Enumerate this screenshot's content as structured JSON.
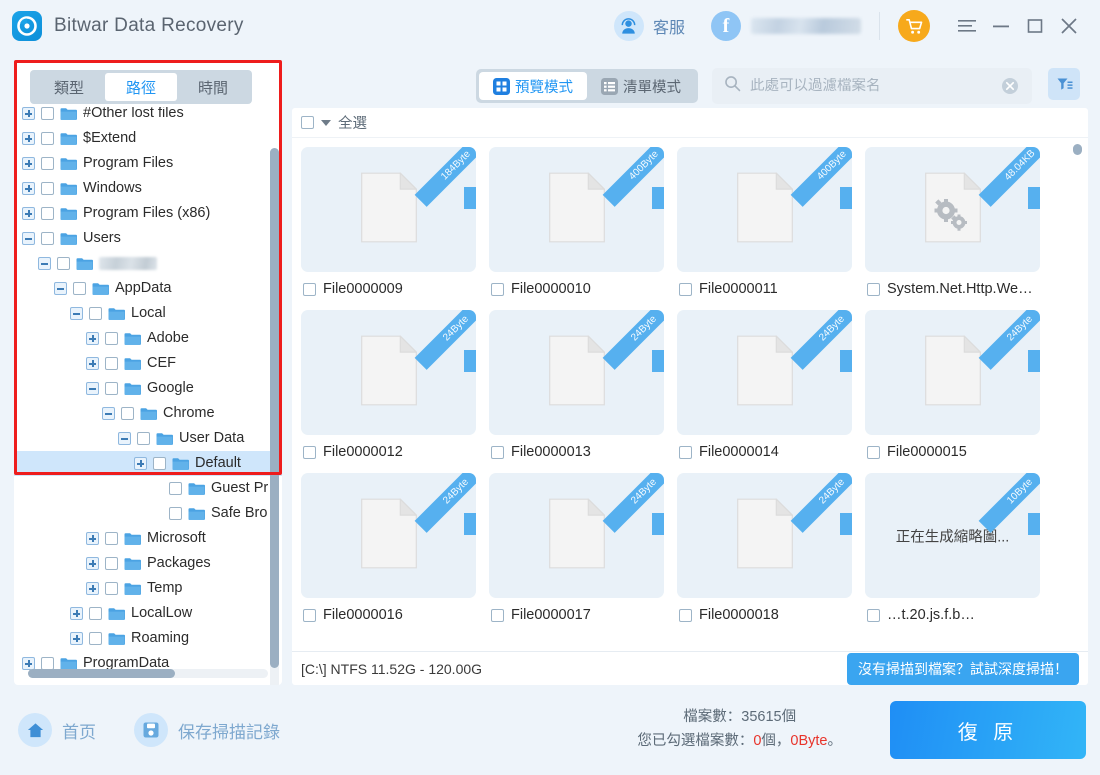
{
  "window": {
    "title": "Bitwar Data Recovery",
    "logo_icon": "bitwar-logo-icon",
    "support_label": "客服",
    "support_icon": "headset-avatar-icon",
    "facebook_icon": "facebook-icon",
    "account_name_redacted": "",
    "cart_icon": "shopping-cart-icon",
    "menu_icon": "hamburger-menu-icon",
    "minimize_icon": "minimize-icon",
    "maximize_icon": "maximize-icon",
    "close_icon": "close-icon"
  },
  "sidebar": {
    "tabs": [
      {
        "label": "類型",
        "active": false
      },
      {
        "label": "路徑",
        "active": true
      },
      {
        "label": "時間",
        "active": false
      }
    ],
    "tree": [
      {
        "label": "#Other lost files",
        "indent": 0,
        "expander": "plus",
        "checkbox": true,
        "selected": false,
        "blurred": false,
        "clipped_top": true
      },
      {
        "label": "$Extend",
        "indent": 0,
        "expander": "plus",
        "checkbox": true,
        "selected": false,
        "blurred": false
      },
      {
        "label": "Program Files",
        "indent": 0,
        "expander": "plus",
        "checkbox": true,
        "selected": false,
        "blurred": false
      },
      {
        "label": "Windows",
        "indent": 0,
        "expander": "plus",
        "checkbox": true,
        "selected": false,
        "blurred": false
      },
      {
        "label": "Program Files (x86)",
        "indent": 0,
        "expander": "plus",
        "checkbox": true,
        "selected": false,
        "blurred": false
      },
      {
        "label": "Users",
        "indent": 0,
        "expander": "minus",
        "checkbox": true,
        "selected": false,
        "blurred": false
      },
      {
        "label": "",
        "indent": 1,
        "expander": "minus",
        "checkbox": true,
        "selected": false,
        "blurred": true
      },
      {
        "label": "AppData",
        "indent": 2,
        "expander": "minus",
        "checkbox": true,
        "selected": false,
        "blurred": false
      },
      {
        "label": "Local",
        "indent": 3,
        "expander": "minus",
        "checkbox": true,
        "selected": false,
        "blurred": false
      },
      {
        "label": "Adobe",
        "indent": 4,
        "expander": "plus",
        "checkbox": true,
        "selected": false,
        "blurred": false
      },
      {
        "label": "CEF",
        "indent": 4,
        "expander": "plus",
        "checkbox": true,
        "selected": false,
        "blurred": false
      },
      {
        "label": "Google",
        "indent": 4,
        "expander": "minus",
        "checkbox": true,
        "selected": false,
        "blurred": false
      },
      {
        "label": "Chrome",
        "indent": 5,
        "expander": "minus",
        "checkbox": true,
        "selected": false,
        "blurred": false
      },
      {
        "label": "User Data",
        "indent": 6,
        "expander": "minus",
        "checkbox": true,
        "selected": false,
        "blurred": false
      },
      {
        "label": "Default",
        "indent": 7,
        "expander": "plus",
        "checkbox": true,
        "selected": true,
        "blurred": false
      },
      {
        "label": "Guest Pr",
        "indent": 8,
        "expander": "none",
        "checkbox": true,
        "selected": false,
        "blurred": false
      },
      {
        "label": "Safe Bro",
        "indent": 8,
        "expander": "none",
        "checkbox": true,
        "selected": false,
        "blurred": false
      },
      {
        "label": "Microsoft",
        "indent": 4,
        "expander": "plus",
        "checkbox": true,
        "selected": false,
        "blurred": false
      },
      {
        "label": "Packages",
        "indent": 4,
        "expander": "plus",
        "checkbox": true,
        "selected": false,
        "blurred": false
      },
      {
        "label": "Temp",
        "indent": 4,
        "expander": "plus",
        "checkbox": true,
        "selected": false,
        "blurred": false
      },
      {
        "label": "LocalLow",
        "indent": 3,
        "expander": "plus",
        "checkbox": true,
        "selected": false,
        "blurred": false
      },
      {
        "label": "Roaming",
        "indent": 3,
        "expander": "plus",
        "checkbox": true,
        "selected": false,
        "blurred": false
      },
      {
        "label": "ProgramData",
        "indent": 0,
        "expander": "plus",
        "checkbox": true,
        "selected": false,
        "blurred": false
      }
    ]
  },
  "toolbar": {
    "modes": [
      {
        "label": "預覽模式",
        "icon": "grid-view-icon",
        "active": true
      },
      {
        "label": "清單模式",
        "icon": "list-view-icon",
        "active": false
      }
    ],
    "search": {
      "placeholder": "此處可以過濾檔案名",
      "value": "",
      "search_icon": "search-icon",
      "clear_icon": "clear-circle-icon"
    },
    "filter_icon": "funnel-filter-icon"
  },
  "main": {
    "select_all_label": "全選",
    "files": [
      {
        "name": "File0000009",
        "size": "184Byte",
        "icon": "blank-document-icon",
        "state": "ready"
      },
      {
        "name": "File0000010",
        "size": "400Byte",
        "icon": "blank-document-icon",
        "state": "ready"
      },
      {
        "name": "File0000011",
        "size": "400Byte",
        "icon": "blank-document-icon",
        "state": "ready"
      },
      {
        "name": "System.Net.Http.We…",
        "size": "48.04KB",
        "icon": "system-dll-document-icon",
        "state": "ready"
      },
      {
        "name": "File0000012",
        "size": "24Byte",
        "icon": "blank-document-icon",
        "state": "ready"
      },
      {
        "name": "File0000013",
        "size": "24Byte",
        "icon": "blank-document-icon",
        "state": "ready"
      },
      {
        "name": "File0000014",
        "size": "24Byte",
        "icon": "blank-document-icon",
        "state": "ready"
      },
      {
        "name": "File0000015",
        "size": "24Byte",
        "icon": "blank-document-icon",
        "state": "ready"
      },
      {
        "name": "File0000016",
        "size": "24Byte",
        "icon": "blank-document-icon",
        "state": "ready"
      },
      {
        "name": "File0000017",
        "size": "24Byte",
        "icon": "blank-document-icon",
        "state": "ready"
      },
      {
        "name": "File0000018",
        "size": "24Byte",
        "icon": "blank-document-icon",
        "state": "ready"
      },
      {
        "name": "…t.20.js.f.b…",
        "size": "10Byte",
        "icon": "thumbnail-pending",
        "state": "generating",
        "placeholder_text": "正在生成縮略圖..."
      }
    ],
    "disk_info": "[C:\\] NTFS 11.52G - 120.00G",
    "deep_scan_label": "沒有掃描到檔案？試試深度掃描！"
  },
  "footer": {
    "home_label": "首页",
    "home_icon": "home-icon",
    "save_label": "保存掃描記錄",
    "save_icon": "save-disk-icon",
    "file_count_text": "檔案數：35615個",
    "selected_prefix": "您已勾選檔案數：",
    "selected_count": "0",
    "selected_count_unit": "個",
    "selected_sep": "，",
    "selected_size": "0Byte",
    "selected_suffix": "。",
    "restore_label": "復 原"
  },
  "colors": {
    "accent_blue": "#2196f3",
    "window_bg": "#eef4fa",
    "card_bg": "#e9f1f8",
    "ribbon_blue": "#56b0ef",
    "cart_orange": "#f7a91b",
    "highlight_red": "#ee1c1c",
    "selected_row": "#cfe6fb",
    "restore_gradient_from": "#1f8ef5",
    "restore_gradient_to": "#32b5f7"
  }
}
